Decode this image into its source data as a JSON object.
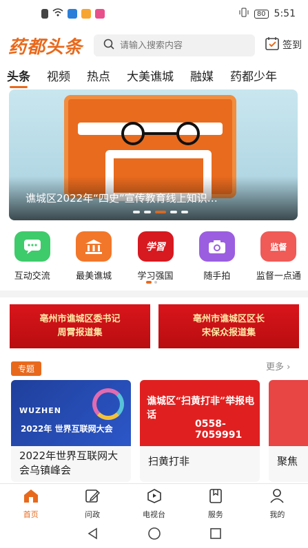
{
  "status_bar": {
    "time": "5:51",
    "battery": "80"
  },
  "header": {
    "logo_text": "药都头条",
    "search_placeholder": "请输入搜索内容",
    "signin_label": "签到"
  },
  "tabs": [
    "头条",
    "视频",
    "热点",
    "大美谯城",
    "融媒",
    "药都少年"
  ],
  "banner": {
    "title": "谯城区2022年“四史”宣传教育线上知识…"
  },
  "quick": [
    {
      "label": "互动交流",
      "color": "#3ecb6b",
      "icon": "chat-icon"
    },
    {
      "label": "最美谯城",
      "color": "#f2772a",
      "icon": "temple-icon"
    },
    {
      "label": "学习强国",
      "color": "#d71920",
      "icon": "xuexi-icon",
      "glyph": "学習"
    },
    {
      "label": "随手拍",
      "color": "#9b5ee0",
      "icon": "camera-icon"
    },
    {
      "label": "监督一点通",
      "color": "#f05a57",
      "icon": "supervise-icon",
      "glyph": "监督"
    }
  ],
  "red_banners": [
    {
      "line1": "亳州市谯城区委书记",
      "line2": "周霄报道集"
    },
    {
      "line1": "亳州市谯城区区长",
      "line2": "宋保众报道集"
    }
  ],
  "topic": {
    "tag": "专题",
    "more": "更多"
  },
  "cards": [
    {
      "title": "2022年世界互联网大会乌镇峰会",
      "img_line1": "WUZHEN",
      "img_line2": "2022年 世界互联网大会"
    },
    {
      "title": "扫黄打非",
      "img_line1": "谯城区“扫黄打非”举报电话",
      "img_line2": "0558-7059991"
    },
    {
      "title": "聚焦"
    }
  ],
  "bottom_nav": [
    "首页",
    "问政",
    "电视台",
    "服务",
    "我的"
  ]
}
